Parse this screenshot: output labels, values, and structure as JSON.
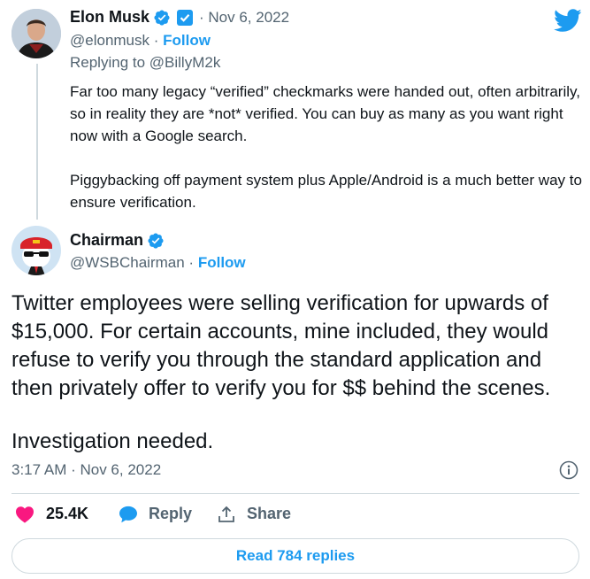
{
  "reply_tweet": {
    "author_name": "Elon Musk",
    "handle": "@elonmusk",
    "separator": "·",
    "follow_label": "Follow",
    "date": "· Nov 6, 2022",
    "replying_to": "Replying to @BillyM2k",
    "paragraphs": [
      "Far too many legacy “verified” checkmarks were handed out, often arbitrarily, so in reality they are *not* verified. You can buy as many as you want right now with a Google search.",
      "Piggybacking off payment system plus Apple/Android is a much better way to ensure verification."
    ]
  },
  "main_tweet": {
    "author_name": "Chairman",
    "handle": "@WSBChairman",
    "follow_label": "Follow",
    "paragraphs": [
      "Twitter employees were selling verification for upwards of $15,000. For certain accounts, mine included, they would refuse to verify you through the standard application and then privately offer to verify you for $$ behind the scenes.",
      "Investigation needed."
    ],
    "timestamp": "3:17 AM · Nov 6, 2022"
  },
  "actions": {
    "like_count": "25.4K",
    "reply_label": "Reply",
    "share_label": "Share"
  },
  "read_replies_label": "Read 784 replies",
  "colors": {
    "accent": "#1d9bf0",
    "like": "#f91880",
    "muted_text": "#536471",
    "border": "#cfd9de"
  },
  "icons": [
    "twitter-bird-icon",
    "verified-badge-icon",
    "government-badge-icon",
    "info-icon",
    "heart-icon",
    "reply-bubble-icon",
    "share-icon"
  ]
}
